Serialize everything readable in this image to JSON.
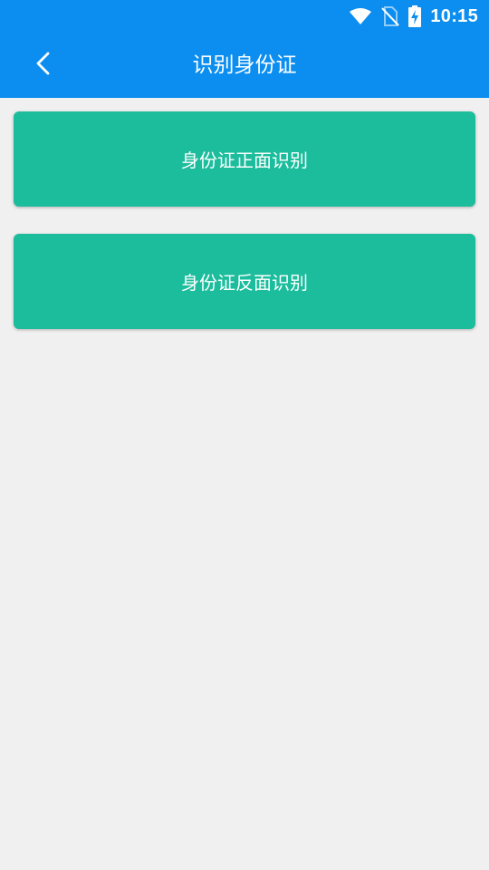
{
  "status_bar": {
    "time": "10:15",
    "icons": [
      "wifi-icon",
      "no-sim-icon",
      "battery-charging-icon"
    ]
  },
  "app_bar": {
    "title": "识别身份证",
    "back_icon": "chevron-left-icon"
  },
  "actions": [
    {
      "label": "身份证正面识别"
    },
    {
      "label": "身份证反面识别"
    }
  ],
  "colors": {
    "primary": "#0b8ef0",
    "card": "#1bbd9c",
    "background": "#f0f0f0",
    "text_on_primary": "#ffffff"
  }
}
